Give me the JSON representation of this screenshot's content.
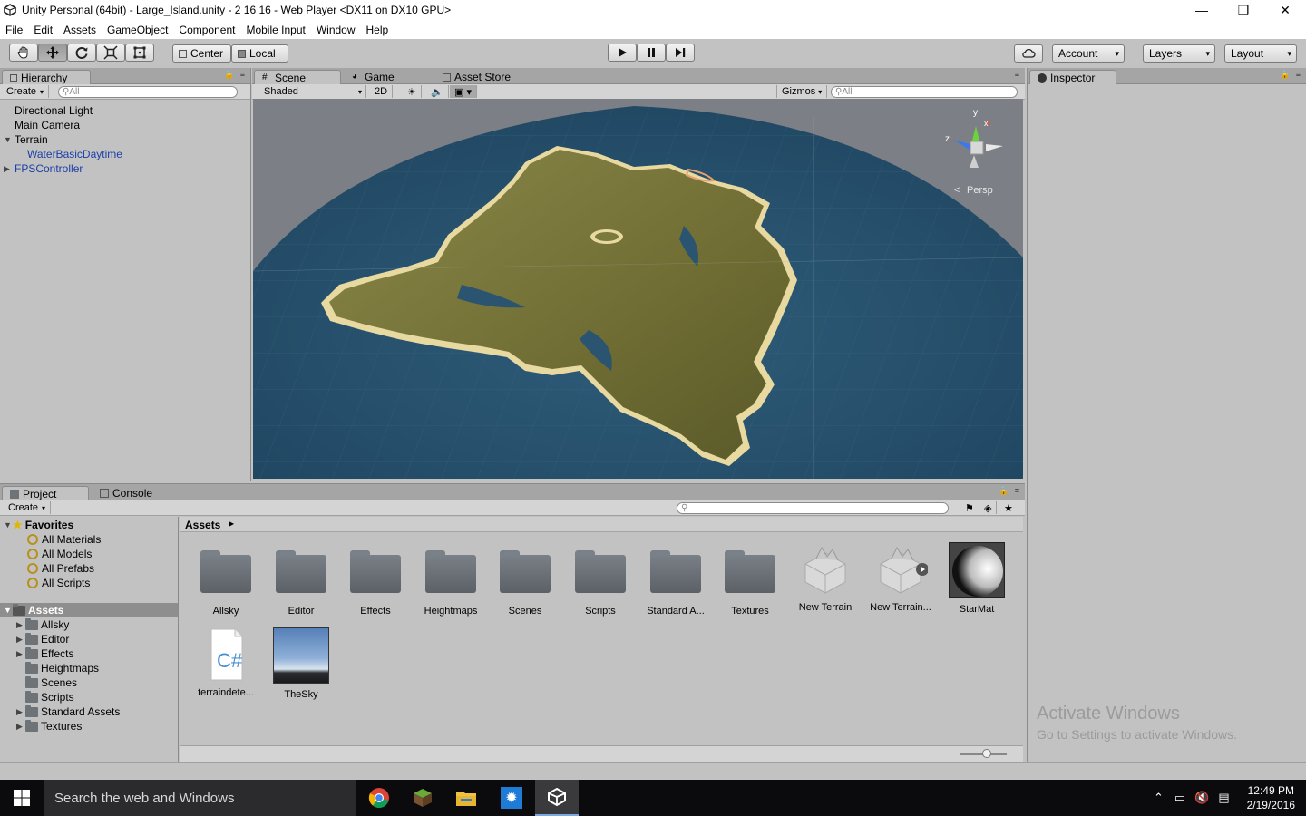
{
  "window": {
    "title": "Unity Personal (64bit) - Large_Island.unity - 2 16 16 - Web Player <DX11 on DX10 GPU>",
    "minimize": "—",
    "maximize": "❐",
    "close": "✕"
  },
  "menu": [
    "File",
    "Edit",
    "Assets",
    "GameObject",
    "Component",
    "Mobile Input",
    "Window",
    "Help"
  ],
  "toolbar": {
    "pivot": "Center",
    "space": "Local",
    "account": "Account",
    "layers": "Layers",
    "layout": "Layout"
  },
  "hierarchy": {
    "tab": "Hierarchy",
    "create": "Create",
    "search_placeholder": "All",
    "items": [
      "Directional Light",
      "Main Camera",
      "Terrain",
      "WaterBasicDaytime",
      "FPSController"
    ]
  },
  "scene": {
    "tabs": [
      "Scene",
      "Game",
      "Asset Store"
    ],
    "shading": "Shaded",
    "mode_2d": "2D",
    "gizmos": "Gizmos",
    "search_placeholder": "All",
    "gizmo_labels": {
      "y": "y",
      "x": "x",
      "z": "z"
    },
    "projection": "Persp"
  },
  "inspector": {
    "tab": "Inspector"
  },
  "project": {
    "tabs": [
      "Project",
      "Console"
    ],
    "create": "Create",
    "favorites_label": "Favorites",
    "favorites": [
      "All Materials",
      "All Models",
      "All Prefabs",
      "All Scripts"
    ],
    "assets_label": "Assets",
    "folders": [
      "Allsky",
      "Editor",
      "Effects",
      "Heightmaps",
      "Scenes",
      "Scripts",
      "Standard Assets",
      "Textures"
    ],
    "breadcrumb": "Assets",
    "grid": [
      {
        "name": "Allsky",
        "kind": "folder"
      },
      {
        "name": "Editor",
        "kind": "folder"
      },
      {
        "name": "Effects",
        "kind": "folder"
      },
      {
        "name": "Heightmaps",
        "kind": "folder"
      },
      {
        "name": "Scenes",
        "kind": "folder"
      },
      {
        "name": "Scripts",
        "kind": "folder"
      },
      {
        "name": "Standard A...",
        "kind": "folder"
      },
      {
        "name": "Textures",
        "kind": "folder"
      },
      {
        "name": "New Terrain",
        "kind": "terrain"
      },
      {
        "name": "New Terrain...",
        "kind": "terrain"
      },
      {
        "name": "StarMat",
        "kind": "material"
      },
      {
        "name": "terraindete...",
        "kind": "script"
      },
      {
        "name": "TheSky",
        "kind": "skybox"
      }
    ]
  },
  "watermark": {
    "line1": "Activate Windows",
    "line2": "Go to Settings to activate Windows."
  },
  "taskbar": {
    "search": "Search the web and Windows",
    "time": "12:49 PM",
    "date": "2/19/2016"
  },
  "colors": {
    "editor_bg": "#c2c2c2",
    "scene_sky": "#7d7f86",
    "water": "#2c5673",
    "terrain": "#7d7a3c",
    "link_blue": "#1c3fa8"
  }
}
